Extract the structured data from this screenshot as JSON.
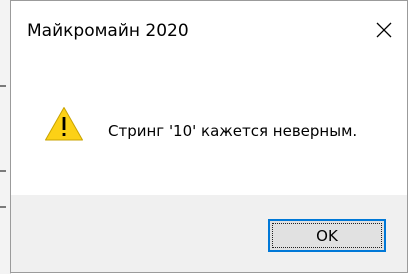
{
  "dialog": {
    "title": "Майкромайн 2020",
    "message": "Стринг '10' кажется неверным.",
    "icon": "warning-icon",
    "ok_label": "OK",
    "close_icon": "close-icon"
  },
  "colors": {
    "accent": "#0078d7",
    "footer": "#f0f0f0",
    "warning_fill": "#fcd116"
  }
}
